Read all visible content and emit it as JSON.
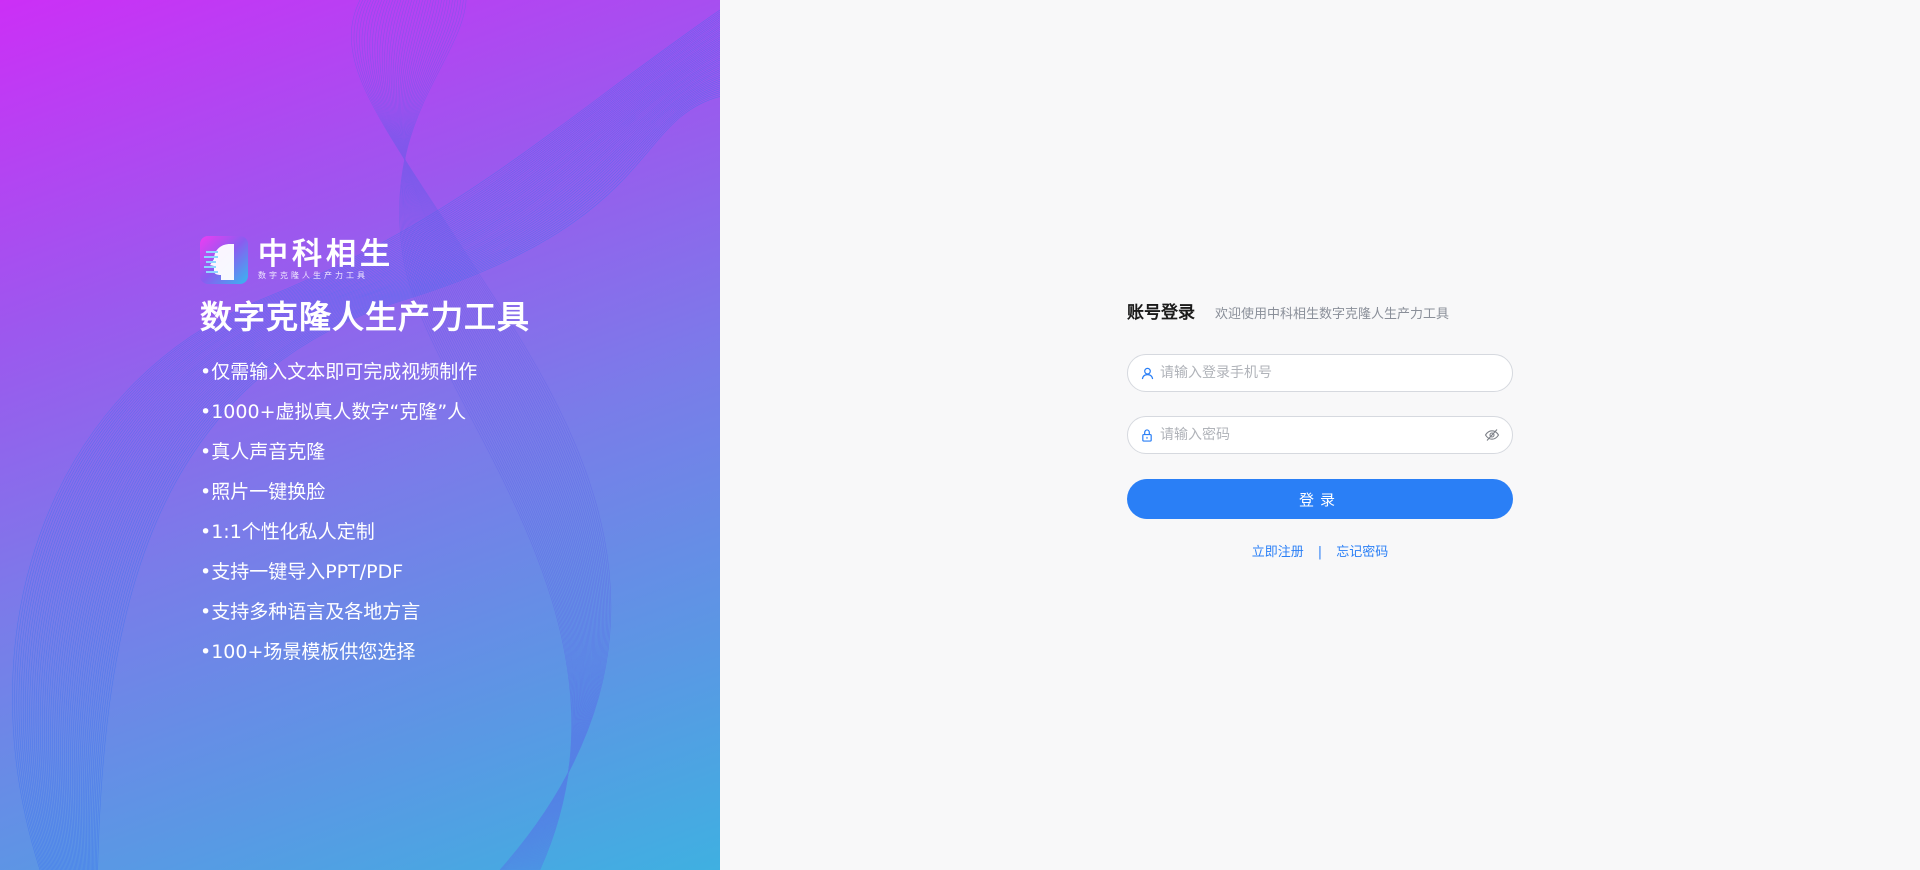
{
  "brand": {
    "name": "中科相生",
    "subtitle": "数字克隆人生产力工具"
  },
  "hero": {
    "tagline": "数字克隆人生产力工具",
    "features": [
      "仅需输入文本即可完成视频制作",
      "1000+虚拟真人数字“克隆”人",
      "真人声音克隆",
      "照片一键换脸",
      "1:1个性化私人定制",
      "支持一键导入PPT/PDF",
      "支持多种语言及各地方言",
      "100+场景模板供您选择"
    ]
  },
  "login": {
    "title": "账号登录",
    "welcome": "欢迎使用中科相生数字克隆人生产力工具",
    "phone_placeholder": "请输入登录手机号",
    "password_placeholder": "请输入密码",
    "submit_label": "登录",
    "register_label": "立即注册",
    "separator": "|",
    "forgot_label": "忘记密码"
  },
  "icons": {
    "phone_field": "user-icon",
    "password_field": "lock-icon",
    "password_toggle": "eye-off-icon"
  },
  "colors": {
    "accent": "#2a7ff6",
    "hero_gradient_start": "#cc2ff6",
    "hero_gradient_end": "#3fb0e1",
    "login_background": "#f8f8f9"
  }
}
